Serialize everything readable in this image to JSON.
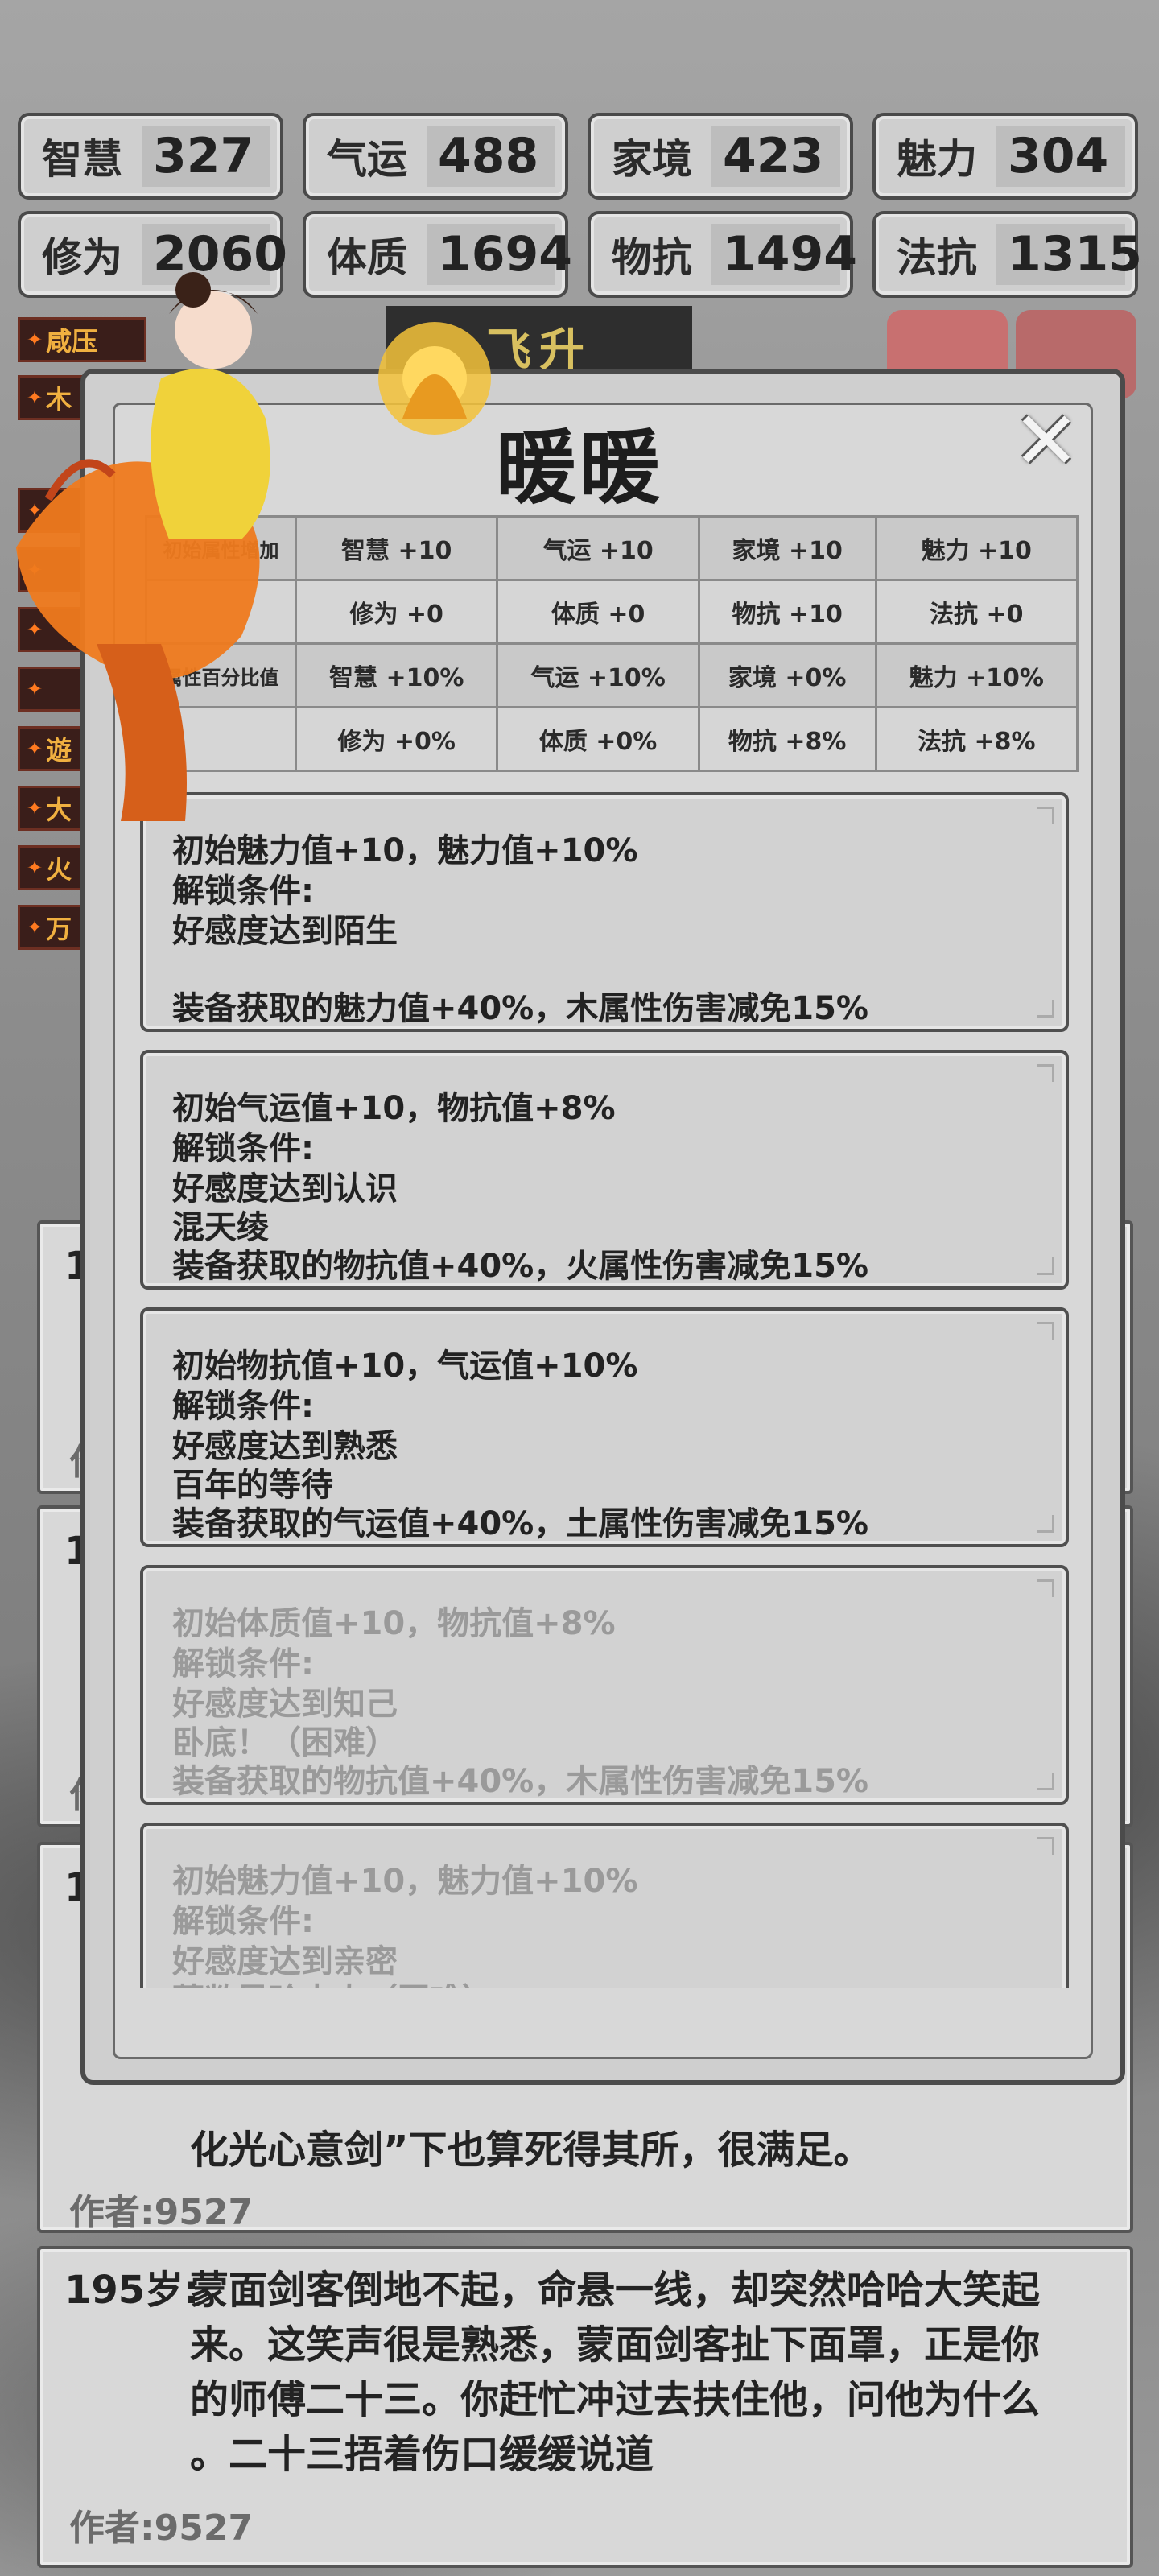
{
  "stats": [
    {
      "label": "智慧",
      "value": "327"
    },
    {
      "label": "气运",
      "value": "488"
    },
    {
      "label": "家境",
      "value": "423"
    },
    {
      "label": "魅力",
      "value": "304"
    },
    {
      "label": "修为",
      "value": "2060"
    },
    {
      "label": "体质",
      "value": "1694"
    },
    {
      "label": "物抗",
      "value": "1494"
    },
    {
      "label": "法抗",
      "value": "1315"
    }
  ],
  "skill_tags": [
    "咸压",
    "木",
    "",
    "",
    "",
    "",
    "遊",
    "大",
    "火",
    "万"
  ],
  "ascend_label": "飞升",
  "modal": {
    "title": "暖暖",
    "close_icon": "close-x-icon",
    "attr_table": {
      "row1_header": "初始属性增加",
      "row1": [
        "智慧 +10",
        "气运 +10",
        "家境 +10",
        "魅力 +10"
      ],
      "row2": [
        "修为 +0",
        "体质 +0",
        "物抗 +10",
        "法抗 +0"
      ],
      "row3_header": "属性百分比值",
      "row3": [
        "智慧 +10%",
        "气运 +10%",
        "家境 +0%",
        "魅力 +10%"
      ],
      "row4": [
        "修为 +0%",
        "体质 +0%",
        "物抗 +8%",
        "法抗 +8%"
      ]
    },
    "cards": [
      {
        "l1": "初始魅力值+10，魅力值+10%",
        "l2": "解锁条件:",
        "l3": "好感度达到陌生",
        "l4": "",
        "l5": "装备获取的魅力值+40%，木属性伤害减免15%",
        "locked": false
      },
      {
        "l1": "初始气运值+10，物抗值+8%",
        "l2": "解锁条件:",
        "l3": "好感度达到认识",
        "l4": "混天绫",
        "l5": "装备获取的物抗值+40%，火属性伤害减免15%",
        "locked": false
      },
      {
        "l1": "初始物抗值+10，气运值+10%",
        "l2": "解锁条件:",
        "l3": "好感度达到熟悉",
        "l4": "百年的等待",
        "l5": "装备获取的气运值+40%，土属性伤害减免15%",
        "locked": false
      },
      {
        "l1": "初始体质值+10，物抗值+8%",
        "l2": "解锁条件:",
        "l3": "好感度达到知己",
        "l4": "卧底！（困难）",
        "l5": "装备获取的物抗值+40%，木属性伤害减免15%",
        "locked": true
      },
      {
        "l1": "初始魅力值+10，魅力值+10%",
        "l2": "解锁条件:",
        "l3": "好感度达到亲密",
        "l4": "蒙敝是珍夫人（困难）",
        "l5": "",
        "locked": true
      }
    ]
  },
  "stories": [
    {
      "age": "1",
      "text": "",
      "author": "作"
    },
    {
      "age": "1",
      "text": "",
      "author": "作"
    },
    {
      "age": "1",
      "text_tail": "化光心意剑”下也算死得其所，很满足。",
      "author": "作者:9527"
    },
    {
      "age": "195岁:",
      "text1": "蒙面剑客倒地不起，命悬一线，却突然哈哈大笑起",
      "text2": "来。这笑声很是熟悉，蒙面剑客扯下面罩，正是你",
      "text3": "的师傅二十三。你赶忙冲过去扶住他，问他为什么",
      "text4": "。二十三捂着伤口缓缓说道",
      "author": "作者:9527"
    }
  ]
}
